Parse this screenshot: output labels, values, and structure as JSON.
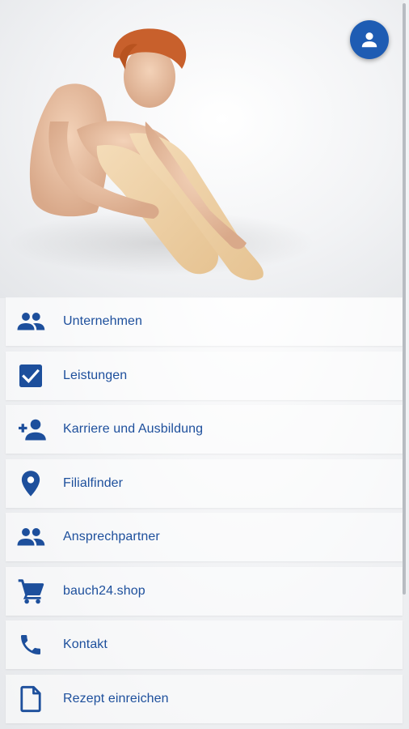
{
  "hero": {
    "image": "woman-sitting-compression-stockings-photo"
  },
  "header": {
    "profile_icon": "account-icon"
  },
  "colors": {
    "brand_blue": "#1d4f9c",
    "profile_button": "#1e5cb3"
  },
  "menu": {
    "items": [
      {
        "label": "Unternehmen",
        "icon": "group-icon"
      },
      {
        "label": "Leistungen",
        "icon": "checkbox-icon"
      },
      {
        "label": "Karriere und Ausbildung",
        "icon": "person-add-icon"
      },
      {
        "label": "Filialfinder",
        "icon": "location-pin-icon"
      },
      {
        "label": "Ansprechpartner",
        "icon": "group-icon"
      },
      {
        "label": "bauch24.shop",
        "icon": "shopping-cart-icon"
      },
      {
        "label": "Kontakt",
        "icon": "phone-icon"
      },
      {
        "label": "Rezept einreichen",
        "icon": "document-icon"
      }
    ]
  }
}
